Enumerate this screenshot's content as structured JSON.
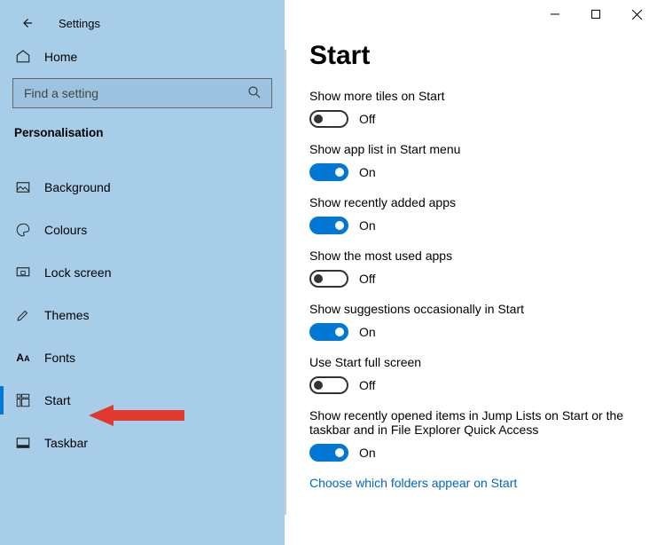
{
  "window": {
    "title": "Settings"
  },
  "sidebar": {
    "home_label": "Home",
    "search_placeholder": "Find a setting",
    "section": "Personalisation",
    "items": [
      {
        "icon": "image-icon",
        "label": "Background"
      },
      {
        "icon": "palette-icon",
        "label": "Colours"
      },
      {
        "icon": "lock-icon",
        "label": "Lock screen"
      },
      {
        "icon": "brush-icon",
        "label": "Themes"
      },
      {
        "icon": "font-icon",
        "label": "Fonts"
      },
      {
        "icon": "start-icon",
        "label": "Start"
      },
      {
        "icon": "taskbar-icon",
        "label": "Taskbar"
      }
    ],
    "selected_index": 5
  },
  "main": {
    "heading": "Start",
    "settings": [
      {
        "label": "Show more tiles on Start",
        "on": false,
        "state": "Off"
      },
      {
        "label": "Show app list in Start menu",
        "on": true,
        "state": "On"
      },
      {
        "label": "Show recently added apps",
        "on": true,
        "state": "On"
      },
      {
        "label": "Show the most used apps",
        "on": false,
        "state": "Off"
      },
      {
        "label": "Show suggestions occasionally in Start",
        "on": true,
        "state": "On"
      },
      {
        "label": "Use Start full screen",
        "on": false,
        "state": "Off"
      },
      {
        "label": "Show recently opened items in Jump Lists on Start or the taskbar and in File Explorer Quick Access",
        "on": true,
        "state": "On"
      }
    ],
    "link": "Choose which folders appear on Start"
  },
  "annotation": {
    "kind": "red-arrow",
    "points_to": "sidebar-item-start"
  }
}
